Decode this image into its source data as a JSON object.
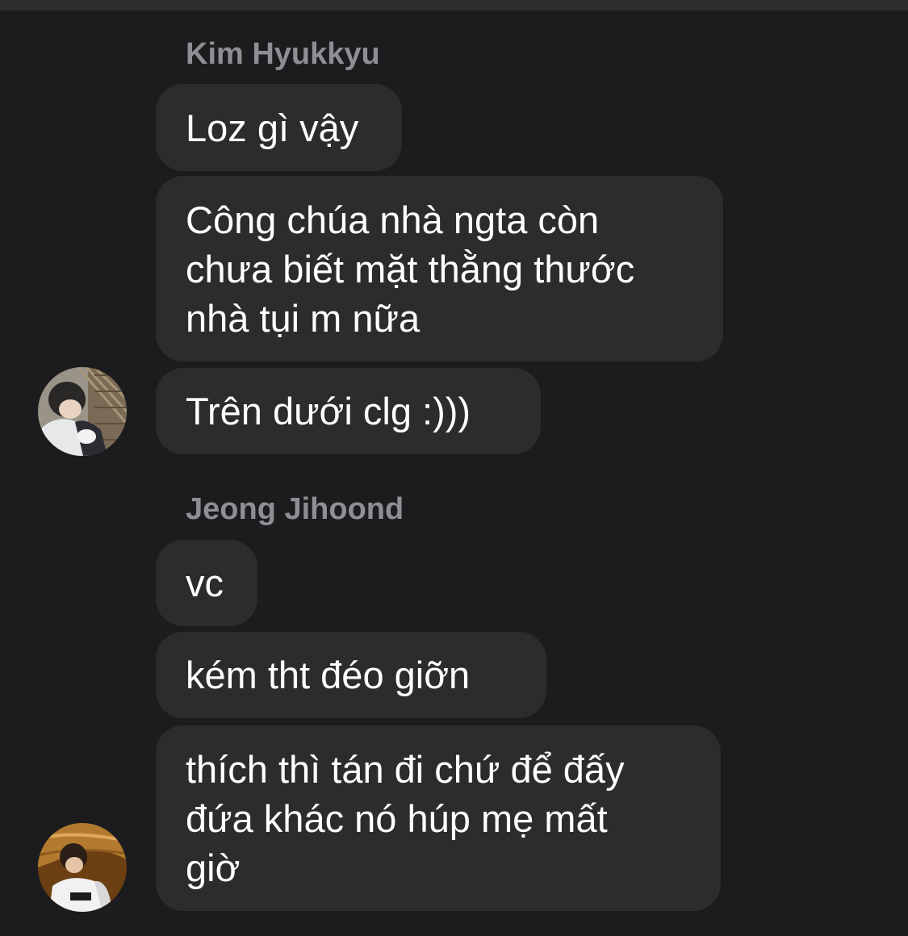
{
  "conversation": {
    "groups": [
      {
        "sender": "Kim Hyukkyu",
        "avatar": "profile-photo-kim-hyukkyu",
        "messages": [
          "Loz gì vậy",
          "Công chúa nhà ngta còn\nchưa biết mặt thằng thước\nnhà tụi m nữa",
          "Trên dưới clg :)))"
        ]
      },
      {
        "sender": "Jeong Jihoond",
        "avatar": "profile-photo-jeong-jihoond",
        "messages": [
          "vc",
          "kém tht đéo giỡn",
          "thích thì tán đi chứ để đấy\nđứa khác nó húp mẹ mất\ngiờ"
        ]
      }
    ]
  }
}
